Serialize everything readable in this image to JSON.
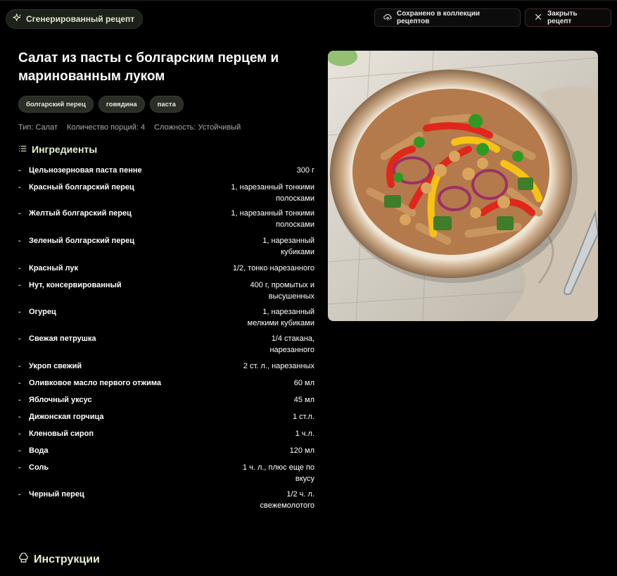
{
  "header": {
    "badge_label": "Сгенерированный рецепт",
    "saved_label": "Сохранено в коллекции рецептов",
    "close_label": "Закрыть рецепт"
  },
  "recipe": {
    "title": "Салат из пасты с болгарским перцем и маринованным луком",
    "tags": [
      "болгарский перец",
      "говядина",
      "паста"
    ],
    "meta": {
      "type": "Тип: Салат",
      "servings": "Количество порций: 4",
      "difficulty": "Сложность: Устойчивый"
    },
    "ingredients_heading": "Ингредиенты",
    "ingredients": [
      {
        "name": "Цельнозерновая паста пенне",
        "amount": "300 г"
      },
      {
        "name": "Красный болгарский перец",
        "amount": "1, нарезанный тонкими полосками"
      },
      {
        "name": "Желтый болгарский перец",
        "amount": "1, нарезанный тонкими полосками"
      },
      {
        "name": "Зеленый болгарский перец",
        "amount": "1, нарезанный кубиками"
      },
      {
        "name": "Красный лук",
        "amount": "1/2, тонко нарезанного"
      },
      {
        "name": "Нут, консервированный",
        "amount": "400 г, промытых и высушенных"
      },
      {
        "name": "Огурец",
        "amount": "1, нарезанный мелкими кубиками"
      },
      {
        "name": "Свежая петрушка",
        "amount": "1/4 стакана, нарезанного"
      },
      {
        "name": "Укроп свежий",
        "amount": "2 ст. л., нарезанных"
      },
      {
        "name": "Оливковое масло первого отжима",
        "amount": "60 мл"
      },
      {
        "name": "Яблочный уксус",
        "amount": "45 мл"
      },
      {
        "name": "Дижонская горчица",
        "amount": "1 ст.л."
      },
      {
        "name": "Кленовый сироп",
        "amount": "1 ч.л."
      },
      {
        "name": "Вода",
        "amount": "120 мл"
      },
      {
        "name": "Соль",
        "amount": "1 ч. л., плюс еще по вкусу"
      },
      {
        "name": "Черный перец",
        "amount": "1/2 ч. л. свежемолотого"
      }
    ],
    "instructions_heading": "Инструкции"
  },
  "colors": {
    "background": "#000000",
    "accent_text": "#e3f0cf",
    "tag_bg": "#2a2e27",
    "close_border": "#4a2626"
  },
  "icons": {
    "badge": "sparkle-icon",
    "saved": "cloud-upload-icon",
    "close": "close-icon",
    "ingredients": "list-icon",
    "instructions": "chef-hat-icon"
  }
}
